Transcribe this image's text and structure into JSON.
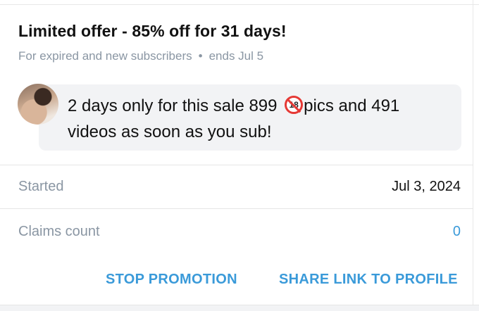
{
  "offer": {
    "title": "Limited offer - 85% off for 31 days!",
    "audience": "For expired and new subscribers",
    "separator": "•",
    "ends": "ends Jul 5"
  },
  "message": {
    "text_before": "2 days only for this sale 899 ",
    "emoji": "18",
    "text_after": "pics and 491 videos as soon as you sub!"
  },
  "details": {
    "started_label": "Started",
    "started_value": "Jul 3, 2024",
    "claims_label": "Claims count",
    "claims_value": "0"
  },
  "actions": {
    "stop_label": "STOP PROMOTION",
    "share_label": "SHARE LINK TO PROFILE"
  },
  "colors": {
    "accent": "#3a9ad9",
    "muted": "#8a96a3",
    "bubble_bg": "#f2f3f5"
  }
}
